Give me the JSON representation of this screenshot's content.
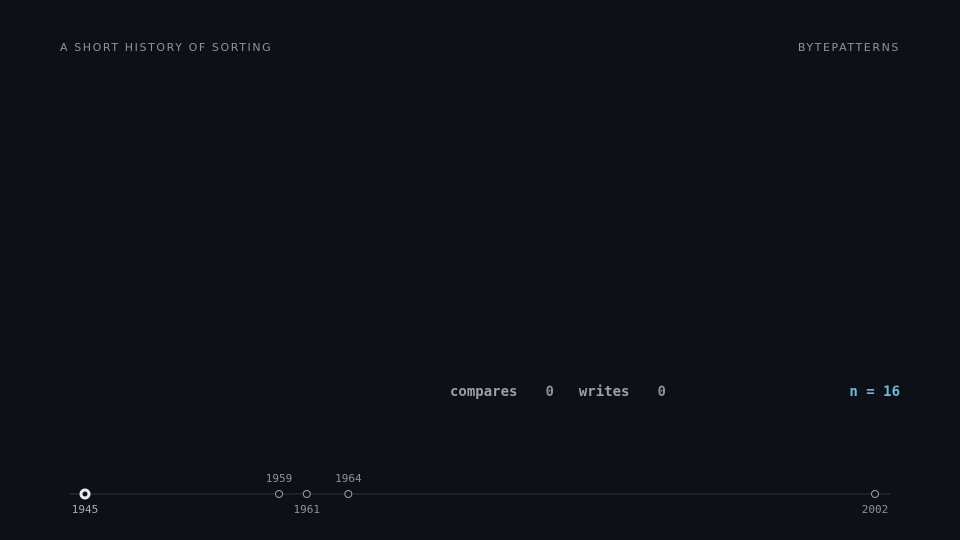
{
  "header": {
    "title": "A SHORT HISTORY OF SORTING",
    "brand": "BYTEPATTERNS"
  },
  "stats": {
    "compares_label": "compares",
    "compares_value": "0",
    "writes_label": "writes",
    "writes_value": "0",
    "n_readout": "n = 16"
  },
  "timeline": {
    "start_year": 1945,
    "end_year": 2002,
    "active_year": "1945",
    "events": [
      {
        "year": "1945",
        "label_pos": "below",
        "active": true
      },
      {
        "year": "1959",
        "label_pos": "above",
        "active": false
      },
      {
        "year": "1961",
        "label_pos": "below",
        "active": false
      },
      {
        "year": "1964",
        "label_pos": "above",
        "active": false
      },
      {
        "year": "2002",
        "label_pos": "below",
        "active": false
      }
    ]
  },
  "colors": {
    "background": "#0d1017",
    "accent": "#74b9dd",
    "text": "#8b919c",
    "track": "#232833",
    "active_marker": "#e8eaee"
  }
}
